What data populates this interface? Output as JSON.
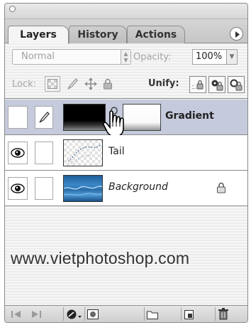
{
  "panel": {
    "tabs": [
      {
        "label": "Layers",
        "active": true
      },
      {
        "label": "History",
        "active": false
      },
      {
        "label": "Actions",
        "active": false
      }
    ]
  },
  "blend": {
    "mode": "Normal",
    "opacity_label": "Opacity:",
    "opacity_value": "100%"
  },
  "lock": {
    "label": "Lock:",
    "unify_label": "Unify:"
  },
  "layers": [
    {
      "name": "Gradient",
      "type": "adjustment",
      "selected": true,
      "visible": false,
      "locked": false,
      "mask_linked": true
    },
    {
      "name": "Tail",
      "type": "normal",
      "selected": false,
      "visible": true,
      "locked": false
    },
    {
      "name": "Background",
      "type": "background",
      "selected": false,
      "visible": true,
      "locked": true
    }
  ],
  "watermark": "www.vietphotoshop.com",
  "icons": {
    "panel_menu": "menu-arrow-icon",
    "eye": "eye-icon",
    "brush": "brush-icon",
    "lock": "lock-icon",
    "cursor": "hand-cursor-icon"
  }
}
